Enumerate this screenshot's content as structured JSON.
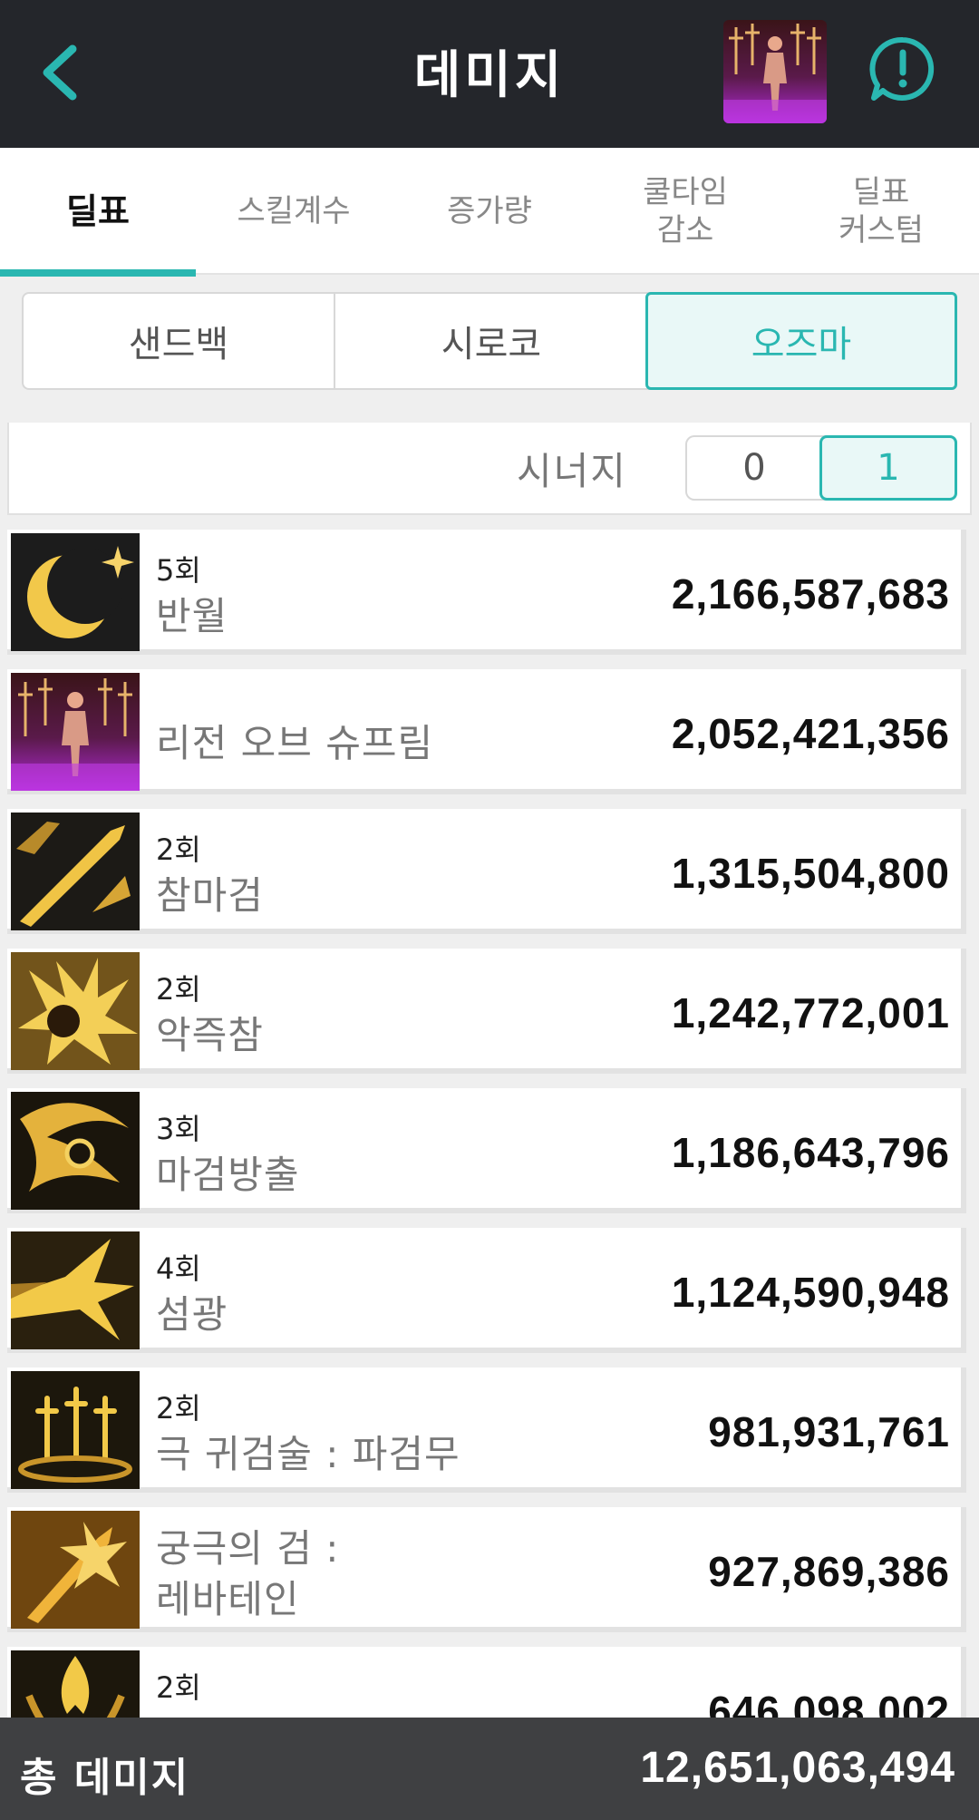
{
  "header": {
    "title": "데미지",
    "back_icon": "chevron-left-icon",
    "avatar_icon": "character-avatar-icon",
    "alert_icon": "exclamation-bubble-icon",
    "accent_color": "#2ab7b1",
    "bar_color": "#24262b"
  },
  "tabs": [
    {
      "label": "딜표",
      "active": true
    },
    {
      "label": "스킬계수",
      "active": false
    },
    {
      "label": "증가량",
      "active": false
    },
    {
      "label": "쿨타임\n감소",
      "active": false
    },
    {
      "label": "딜표\n커스텀",
      "active": false
    }
  ],
  "targets": [
    {
      "label": "샌드백",
      "active": false
    },
    {
      "label": "시로코",
      "active": false
    },
    {
      "label": "오즈마",
      "active": true
    }
  ],
  "synergy": {
    "label": "시너지",
    "options": [
      "0",
      "1"
    ],
    "selected": "1"
  },
  "skills": [
    {
      "count": "5회",
      "name": "반월",
      "damage": "2,166,587,683",
      "icon": "crescent-moon-icon"
    },
    {
      "count": "",
      "name": "리전 오브 슈프림",
      "damage": "2,052,421,356",
      "icon": "legion-of-supreme-icon"
    },
    {
      "count": "2회",
      "name": "참마검",
      "damage": "1,315,504,800",
      "icon": "slash-sword-icon"
    },
    {
      "count": "2회",
      "name": "악즉참",
      "damage": "1,242,772,001",
      "icon": "evil-slash-icon"
    },
    {
      "count": "3회",
      "name": "마검방출",
      "damage": "1,186,643,796",
      "icon": "demon-sword-release-icon"
    },
    {
      "count": "4회",
      "name": "섬광",
      "damage": "1,124,590,948",
      "icon": "flash-icon"
    },
    {
      "count": "2회",
      "name": "극 귀검술 : 파검무",
      "damage": "981,931,761",
      "icon": "sword-dance-icon"
    },
    {
      "count": "",
      "name": "궁극의 검 :\n레바테인",
      "damage": "927,869,386",
      "icon": "laevateinn-icon"
    },
    {
      "count": "2회",
      "name": "",
      "damage": "646,098,002",
      "icon": "flame-sword-icon"
    }
  ],
  "footer": {
    "label": "총 데미지",
    "total": "12,651,063,494"
  }
}
